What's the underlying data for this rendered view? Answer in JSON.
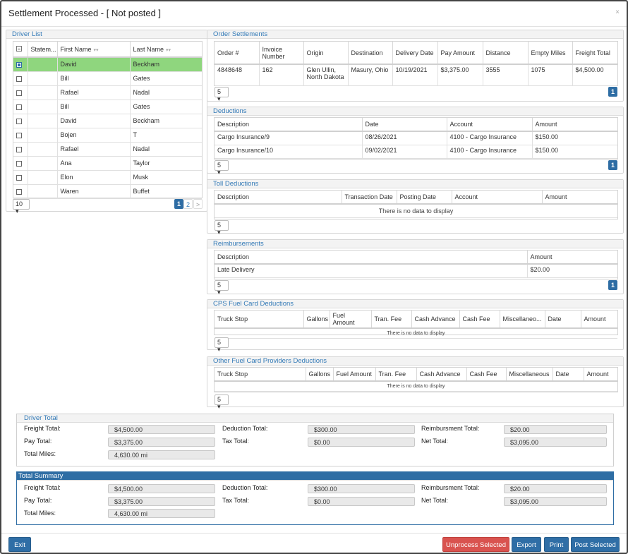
{
  "modal": {
    "title": "Settlement Processed - [ Not posted ]",
    "close": "×"
  },
  "driver_list": {
    "title": "Driver List",
    "headers": {
      "statement": "Statem...",
      "first": "First Name",
      "last": "Last Name"
    },
    "sort_icon": "▾▾",
    "rows": [
      {
        "first": "David",
        "last": "Beckham",
        "checked": true
      },
      {
        "first": "Bill",
        "last": "Gates",
        "checked": false
      },
      {
        "first": "Rafael",
        "last": "Nadal",
        "checked": false
      },
      {
        "first": "Bill",
        "last": "Gates",
        "checked": false
      },
      {
        "first": "David",
        "last": "Beckham",
        "checked": false
      },
      {
        "first": "Bojen",
        "last": "T",
        "checked": false
      },
      {
        "first": "Rafael",
        "last": "Nadal",
        "checked": false
      },
      {
        "first": "Ana",
        "last": "Taylor",
        "checked": false
      },
      {
        "first": "Elon",
        "last": "Musk",
        "checked": false
      },
      {
        "first": "Waren",
        "last": "Buffet",
        "checked": false
      }
    ],
    "page_size": "10 ▾",
    "pages": [
      "1",
      "2",
      ">"
    ]
  },
  "order_settlements": {
    "title": "Order Settlements",
    "headers": [
      "Order #",
      "Invoice Number",
      "Origin",
      "Destination",
      "Delivery Date",
      "Pay Amount",
      "Distance",
      "Empty Miles",
      "Freight Total"
    ],
    "rows": [
      [
        "4848648",
        "162",
        "Glen Ullin, North Dakota",
        "Masury, Ohio",
        "10/19/2021",
        "$3,375.00",
        "3555",
        "1075",
        "$4,500.00"
      ]
    ],
    "page_size": "5 ▾",
    "page": "1"
  },
  "deductions": {
    "title": "Deductions",
    "headers": [
      "Description",
      "Date",
      "Account",
      "Amount"
    ],
    "rows": [
      [
        "Cargo Insurance/9",
        "08/26/2021",
        "4100 - Cargo Insurance",
        "$150.00"
      ],
      [
        "Cargo Insurance/10",
        "09/02/2021",
        "4100 - Cargo Insurance",
        "$150.00"
      ]
    ],
    "page_size": "5 ▾",
    "page": "1"
  },
  "toll_deductions": {
    "title": "Toll Deductions",
    "headers": [
      "Description",
      "Transaction Date",
      "Posting Date",
      "Account",
      "Amount"
    ],
    "empty": "There is no data to display",
    "page_size": "5 ▾"
  },
  "reimbursements": {
    "title": "Reimbursements",
    "headers": [
      "Description",
      "Amount"
    ],
    "rows": [
      [
        "Late Delivery",
        "$20.00"
      ]
    ],
    "page_size": "5 ▾",
    "page": "1"
  },
  "cps_fuel": {
    "title": "CPS Fuel Card Deductions",
    "headers": [
      "Truck Stop",
      "Gallons",
      "Fuel Amount",
      "Tran. Fee",
      "Cash Advance",
      "Cash Fee",
      "Miscellaneo...",
      "Date",
      "Amount"
    ],
    "empty": "There is no data to display",
    "page_size": "5 ▾"
  },
  "other_fuel": {
    "title": "Other Fuel Card Providers Deductions",
    "headers": [
      "Truck Stop",
      "Gallons",
      "Fuel Amount",
      "Tran. Fee",
      "Cash Advance",
      "Cash Fee",
      "Miscellaneous",
      "Date",
      "Amount"
    ],
    "empty": "There is no data to display",
    "page_size": "5 ▾"
  },
  "driver_total": {
    "title": "Driver Total",
    "freight_label": "Freight Total:",
    "freight": "$4,500.00",
    "pay_label": "Pay Total:",
    "pay": "$3,375.00",
    "miles_label": "Total Miles:",
    "miles": "4,630.00 mi",
    "deduction_label": "Deduction Total:",
    "deduction": "$300.00",
    "tax_label": "Tax Total:",
    "tax": "$0.00",
    "reimb_label": "Reimbursment Total:",
    "reimb": "$20.00",
    "net_label": "Net Total:",
    "net": "$3,095.00"
  },
  "total_summary": {
    "title": "Total Summary",
    "freight_label": "Freight Total:",
    "freight": "$4,500.00",
    "pay_label": "Pay Total:",
    "pay": "$3,375.00",
    "miles_label": "Total Miles:",
    "miles": "4,630.00 mi",
    "deduction_label": "Deduction Total:",
    "deduction": "$300.00",
    "tax_label": "Tax Total:",
    "tax": "$0.00",
    "reimb_label": "Reimbursment Total:",
    "reimb": "$20.00",
    "net_label": "Net Total:",
    "net": "$3,095.00"
  },
  "footer": {
    "exit": "Exit",
    "unprocess": "Unprocess Selected",
    "export": "Export",
    "print": "Print",
    "post": "Post Selected"
  },
  "colors": {
    "accent": "#2e6da4",
    "selected_row": "#8fd67e",
    "danger": "#d9534f"
  }
}
